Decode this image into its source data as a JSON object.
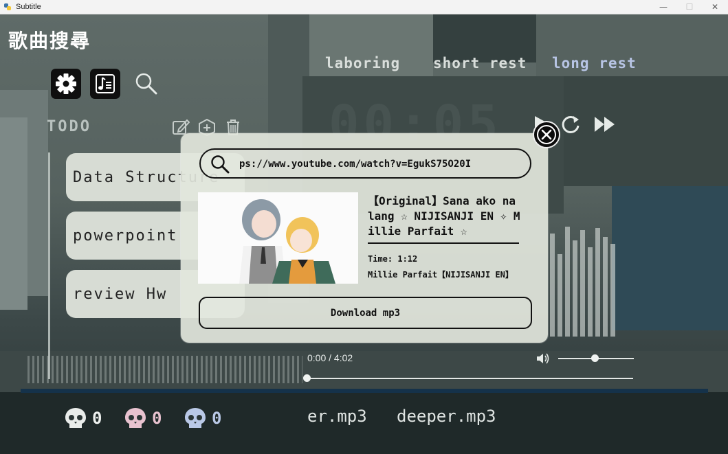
{
  "window": {
    "title": "Subtitle",
    "controls": {
      "minimize": "—",
      "maximize": "☐",
      "close": "✕"
    }
  },
  "app": {
    "heading": "歌曲搜尋",
    "top_icons": [
      "settings-gear-icon",
      "music-note-icon",
      "search-icon"
    ]
  },
  "todo": {
    "label": "TODO",
    "tools": [
      "edit-icon",
      "add-icon",
      "trash-icon"
    ],
    "items": [
      "Data Structure",
      "powerpoint",
      "review Hw"
    ]
  },
  "pomodoro": {
    "tabs": [
      "laboring",
      "short rest",
      "long rest"
    ],
    "active_tab": "long rest",
    "timer": "00:05"
  },
  "player": {
    "time": "0:00 / 4:02",
    "progress": 0.0,
    "volume": 0.5,
    "playlist": [
      "er.mp3",
      "deeper.mp3"
    ],
    "counters": [
      {
        "icon": "skull-icon",
        "count": "0",
        "color": "#e9ecea"
      },
      {
        "icon": "skull-icon",
        "count": "0",
        "color": "#e8c2cf"
      },
      {
        "icon": "skull-icon",
        "count": "0",
        "color": "#b9c8e6"
      }
    ]
  },
  "download_dialog": {
    "url_value": "ps://www.youtube.com/watch?v=EgukS75O20I",
    "song_title": "【Original】Sana ako na lang ☆ NIJISANJI EN ✧ Millie Parfait ☆",
    "time": "Time: 1:12",
    "channel": "Millie Parfait【NIJISANJI EN】",
    "download_label": "Download mp3"
  },
  "colors": {
    "tab_inactive": "#d9dedb",
    "tab_active": "#b7c4e4",
    "modal_bg": "#e2e6dc",
    "accent_dark": "#111111"
  }
}
